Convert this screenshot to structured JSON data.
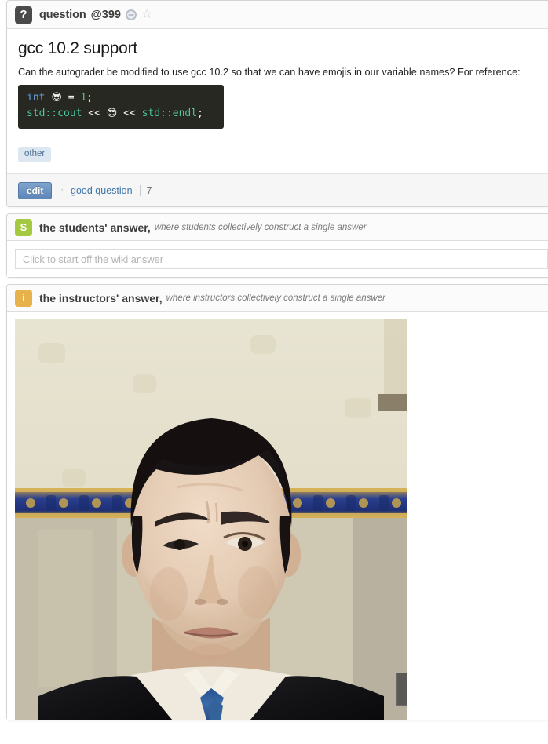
{
  "post": {
    "kind_label": "question",
    "number_label": "@399",
    "icon": "question-mark-badge",
    "unread_icon": "eye-icon",
    "star_icon": "star-icon",
    "title": "gcc 10.2 support",
    "body_text": "Can the autograder be modified to use gcc 10.2 so that we can have emojis in our variable names? For reference:",
    "code": {
      "line1": {
        "kw": "int",
        "emoji": "😎",
        "op": " = ",
        "num": "1",
        "semi": ";"
      },
      "line2": {
        "ns1": "std::cout",
        "op1": " << ",
        "emoji": "😎",
        "op2": " << ",
        "ns2": "std::endl",
        "semi": ";"
      }
    },
    "tags": [
      "other"
    ],
    "actions": {
      "edit_label": "edit",
      "separator": "·",
      "good_question_label": "good question",
      "good_question_count": "7"
    }
  },
  "students_answer": {
    "badge": "S",
    "badge_color": "#a4c83f",
    "title": "the students' answer,",
    "subtitle": "where students collectively construct a single answer",
    "input_placeholder": "Click to start off the wiki answer",
    "input_value": ""
  },
  "instructors_answer": {
    "badge": "i",
    "badge_color": "#e7b24b",
    "title": "the instructors' answer,",
    "subtitle": "where instructors collectively construct a single answer",
    "media": {
      "alt": "photo of a man in a dark suit with a blue tie making a skeptical confused face in an ornate room",
      "scrollbar_handle": "video-scrub-handle"
    }
  },
  "colors": {
    "accent_blue": "#3a74ab",
    "button_blue": "#5d87b8",
    "tag_bg": "#dce7f1",
    "code_bg": "#272822"
  }
}
